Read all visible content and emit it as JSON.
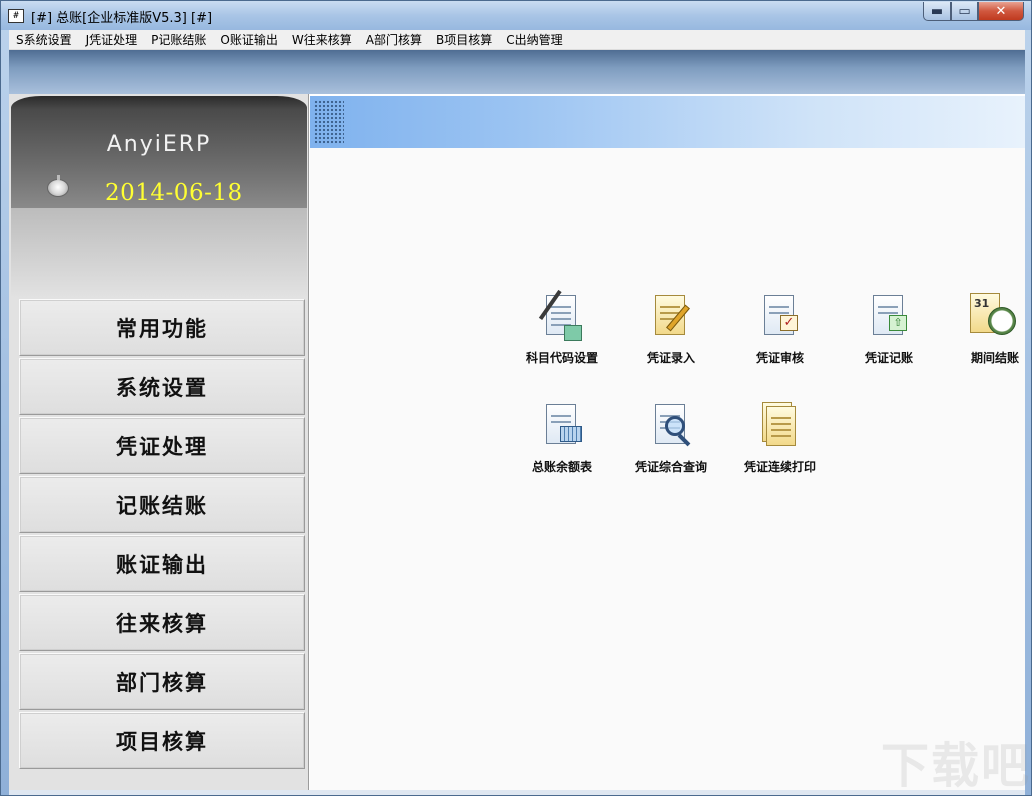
{
  "window": {
    "title": "[#] 总账[企业标准版V5.3] [#]",
    "icon_text": "#",
    "controls": {
      "minimize": "▬",
      "maximize": "▭",
      "close": "✕"
    }
  },
  "menubar": {
    "items": [
      {
        "label": "S系统设置"
      },
      {
        "label": "J凭证处理"
      },
      {
        "label": "P记账结账"
      },
      {
        "label": "O账证输出"
      },
      {
        "label": "W往来核算"
      },
      {
        "label": "A部门核算"
      },
      {
        "label": "B项目核算"
      },
      {
        "label": "C出纳管理"
      }
    ]
  },
  "sidebar": {
    "brand": "AnyiERP",
    "date": "2014-06-18",
    "nav": [
      {
        "label": "常用功能"
      },
      {
        "label": "系统设置"
      },
      {
        "label": "凭证处理"
      },
      {
        "label": "记账结账"
      },
      {
        "label": "账证输出"
      },
      {
        "label": "往来核算"
      },
      {
        "label": "部门核算"
      },
      {
        "label": "项目核算"
      }
    ]
  },
  "functions": [
    {
      "label": "科目代码设置",
      "icon": "account-code-icon"
    },
    {
      "label": "凭证录入",
      "icon": "voucher-entry-icon"
    },
    {
      "label": "凭证审核",
      "icon": "voucher-audit-icon"
    },
    {
      "label": "凭证记账",
      "icon": "voucher-post-icon"
    },
    {
      "label": "期间结账",
      "icon": "period-close-icon"
    },
    {
      "label": "总账余额表",
      "icon": "ledger-balance-icon"
    },
    {
      "label": "凭证综合查询",
      "icon": "voucher-query-icon"
    },
    {
      "label": "凭证连续打印",
      "icon": "voucher-print-icon"
    }
  ],
  "calendar_day": "31",
  "watermark": "下载吧",
  "colors": {
    "date_text": "#ffff33",
    "header_gradient_start": "#7fb2ee",
    "close_button": "#c03a1f"
  }
}
